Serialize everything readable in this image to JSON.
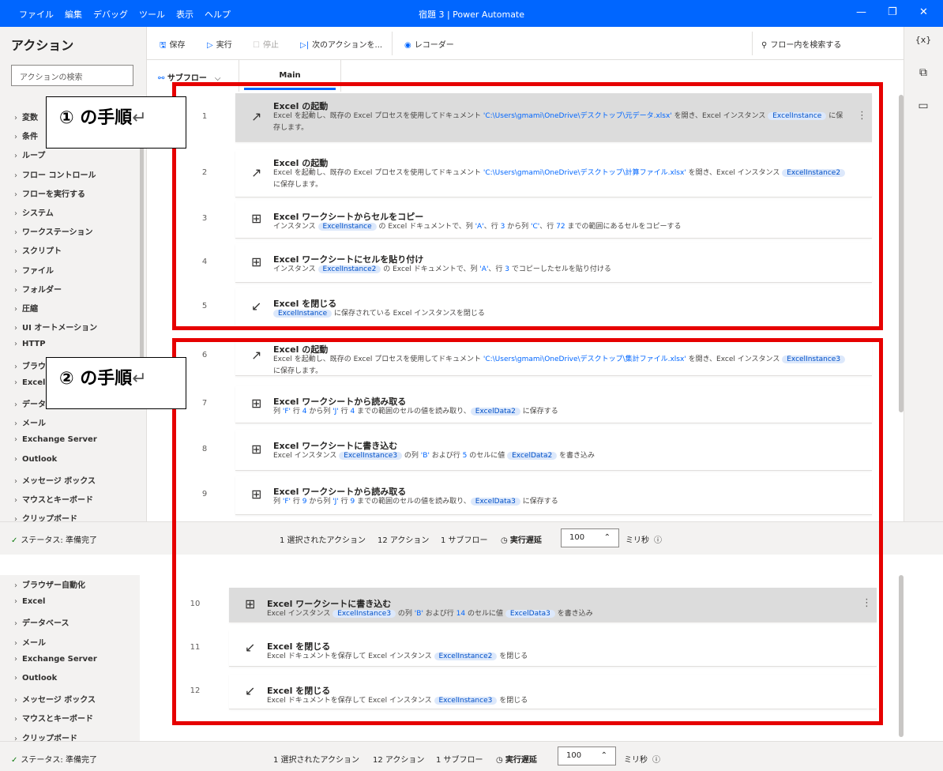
{
  "titlebar": {
    "menu": [
      "ファイル",
      "編集",
      "デバッグ",
      "ツール",
      "表示",
      "ヘルプ"
    ],
    "title": "宿題 3 | Power Automate"
  },
  "left_panel": {
    "title": "アクション",
    "search_placeholder": "アクションの検索",
    "categories": [
      "変数",
      "条件",
      "ループ",
      "フロー コントロール",
      "フローを実行する",
      "システム",
      "ワークステーション",
      "スクリプト",
      "ファイル",
      "フォルダー",
      "圧縮",
      "UI オートメーション",
      "HTTP",
      "ブラウザー自動化",
      "Excel",
      "データベース",
      "メール",
      "Exchange Server",
      "Outlook",
      "メッセージ ボックス",
      "マウスとキーボード",
      "クリップボード"
    ]
  },
  "toolbar": {
    "save": "保存",
    "run": "実行",
    "stop": "停止",
    "next": "次のアクションを...",
    "recorder": "レコーダー",
    "search": "フロー内を検索する"
  },
  "right_rail": {
    "variables": "{x}"
  },
  "tabs": {
    "subflow": "サブフロー",
    "main": "Main"
  },
  "actions": [
    {
      "num": "1",
      "title": "Excel の起動",
      "desc_parts": [
        "Excel を起動し、既存の Excel プロセスを使用してドキュメント ",
        "'C:\\Users\\gmami\\OneDrive\\デスクトップ\\元データ.xlsx'",
        " を開き、Excel インスタンス ",
        "ExcelInstance",
        " に保存します。"
      ]
    },
    {
      "num": "2",
      "title": "Excel の起動",
      "desc_parts": [
        "Excel を起動し、既存の Excel プロセスを使用してドキュメント ",
        "'C:\\Users\\gmami\\OneDrive\\デスクトップ\\計算ファイル.xlsx'",
        " を開き、Excel インスタンス ",
        "ExcelInstance2",
        " に保存します。"
      ]
    },
    {
      "num": "3",
      "title": "Excel ワークシートからセルをコピー",
      "desc_parts": [
        "インスタンス ",
        "ExcelInstance",
        " の Excel ドキュメントで、列 ",
        "'A'",
        "、行 ",
        "3",
        " から列 ",
        "'C'",
        "、行 ",
        "72",
        " までの範囲にあるセルをコピーする"
      ]
    },
    {
      "num": "4",
      "title": "Excel ワークシートにセルを貼り付け",
      "desc_parts": [
        "インスタンス ",
        "ExcelInstance2",
        " の Excel ドキュメントで、列 ",
        "'A'",
        "、行 ",
        "3",
        " でコピーしたセルを貼り付ける"
      ]
    },
    {
      "num": "5",
      "title": "Excel を閉じる",
      "desc_parts": [
        "ExcelInstance",
        " に保存されている Excel インスタンスを閉じる"
      ]
    },
    {
      "num": "6",
      "title": "Excel の起動",
      "desc_parts": [
        "Excel を起動し、既存の Excel プロセスを使用してドキュメント ",
        "'C:\\Users\\gmami\\OneDrive\\デスクトップ\\集計ファイル.xlsx'",
        " を開き、Excel インスタンス ",
        "ExcelInstance3",
        " に保存します。"
      ]
    },
    {
      "num": "7",
      "title": "Excel ワークシートから読み取る",
      "desc_parts": [
        "列 ",
        "'F'",
        " 行 ",
        "4",
        " から列 ",
        "'J'",
        " 行 ",
        "4",
        " までの範囲のセルの値を読み取り、",
        "ExcelData2",
        " に保存する"
      ]
    },
    {
      "num": "8",
      "title": "Excel ワークシートに書き込む",
      "desc_parts": [
        "Excel インスタンス ",
        "ExcelInstance3",
        " の列 ",
        "'B'",
        " および行 ",
        "5",
        " のセルに値 ",
        "ExcelData2",
        " を書き込み"
      ]
    },
    {
      "num": "9",
      "title": "Excel ワークシートから読み取る",
      "desc_parts": [
        "列 ",
        "'F'",
        " 行 ",
        "9",
        " から列 ",
        "'J'",
        " 行 ",
        "9",
        " までの範囲のセルの値を読み取り、",
        "ExcelData3",
        " に保存する"
      ]
    },
    {
      "num": "10",
      "title": "Excel ワークシートに書き込む",
      "desc_parts": [
        "Excel インスタンス ",
        "ExcelInstance3",
        " の列 ",
        "'B'",
        " および行 ",
        "14",
        " のセルに値 ",
        "ExcelData3",
        " を書き込み"
      ]
    },
    {
      "num": "11",
      "title": "Excel を閉じる",
      "desc_parts": [
        "Excel ドキュメントを保存して Excel インスタンス ",
        "ExcelInstance2",
        " を閉じる"
      ]
    },
    {
      "num": "12",
      "title": "Excel を閉じる",
      "desc_parts": [
        "Excel ドキュメントを保存して Excel インスタンス ",
        "ExcelInstance3",
        " を閉じる"
      ]
    }
  ],
  "status": {
    "state": "ステータス: 準備完了",
    "selected": "1 選択されたアクション",
    "actions": "12 アクション",
    "subflows": "1 サブフロー",
    "delay_label": "実行遅延",
    "delay_value": "100",
    "unit": "ミリ秒"
  },
  "callouts": {
    "one": "① の手順",
    "two": "② の手順"
  }
}
